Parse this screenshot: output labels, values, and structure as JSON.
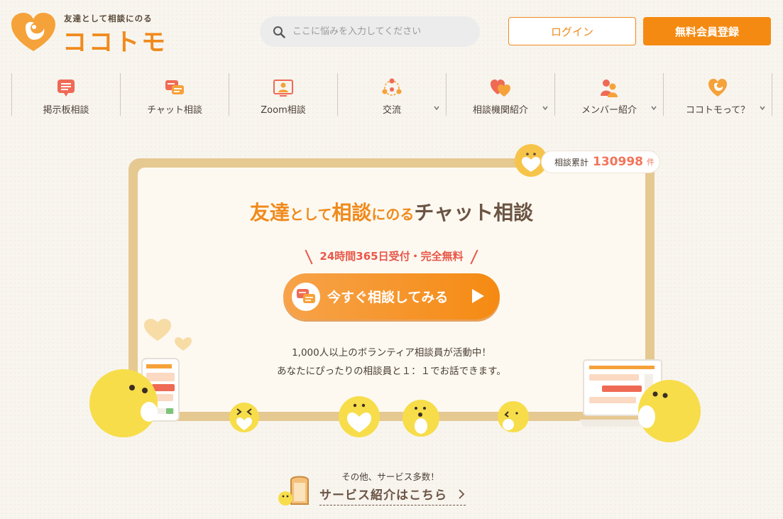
{
  "header": {
    "logo_tagline": "友達として相談にのる",
    "logo_name": "ココトモ",
    "search_placeholder": "ここに悩みを入力してください",
    "login_label": "ログイン",
    "register_label": "無料会員登録"
  },
  "nav": {
    "items": [
      {
        "label": "掲示板相談",
        "icon": "bulletin-board-icon",
        "has_dropdown": false
      },
      {
        "label": "チャット相談",
        "icon": "chat-bubbles-icon",
        "has_dropdown": false
      },
      {
        "label": "Zoom相談",
        "icon": "video-call-icon",
        "has_dropdown": false
      },
      {
        "label": "交流",
        "icon": "community-icon",
        "has_dropdown": true
      },
      {
        "label": "相談機関紹介",
        "icon": "hearts-icon",
        "has_dropdown": true
      },
      {
        "label": "メンバー紹介",
        "icon": "members-icon",
        "has_dropdown": true
      },
      {
        "label": "ココトモって？",
        "icon": "logo-heart-icon",
        "has_dropdown": true
      }
    ]
  },
  "counter": {
    "label": "相談累計",
    "value": "130998",
    "unit": "件"
  },
  "hero": {
    "title_part1": "友達",
    "title_part2": "として",
    "title_part3": "相談",
    "title_part4": "にのる",
    "title_part5": "チャット相談",
    "subtitle": "24時間365日受付・完全無料",
    "cta_label": "今すぐ相談してみる",
    "desc_line1": "1,000人以上のボランティア相談員が活動中！",
    "desc_line2": "あなたにぴったりの相談員と１：１でお話できます。"
  },
  "more": {
    "small_text": "その他、サービス多数！",
    "link_label": "サービス紹介はこちら"
  },
  "colors": {
    "accent": "#f58a12",
    "accent_text": "#f08a1c",
    "brown": "#6b5444",
    "red": "#e8584a",
    "counter_red": "#f2745a",
    "frame": "#e6c891",
    "yellow": "#f7dd4a"
  }
}
